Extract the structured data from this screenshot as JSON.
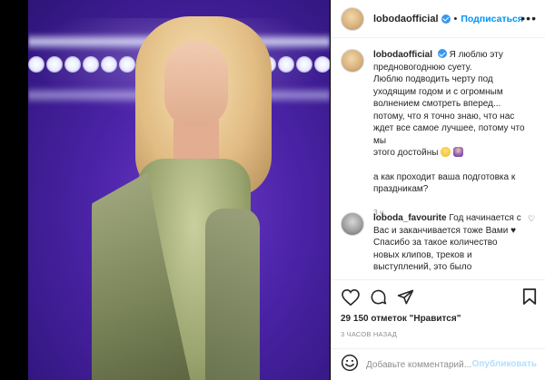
{
  "post": {
    "username": "lobodaofficial",
    "follow_label": "Подписаться",
    "separator": "•",
    "caption_lines": [
      "Я люблю эту",
      "предновогоднюю суету.",
      "Люблю подводить черту под",
      "уходящим годом и с огромным",
      "волнением смотреть вперед...",
      "потому, что я точно знаю, что нас",
      "ждет все самое лучшее, потому что мы",
      "этого достойны"
    ],
    "question_lines": [
      "а как проходит ваша подготовка к",
      "праздникам?"
    ],
    "caption_time": "3 ч.",
    "emoji": [
      "smile-emoji",
      "person-raising-hand-emoji"
    ]
  },
  "comment": {
    "username": "loboda_favourite",
    "text_lines": [
      "Год начинается с",
      "Вас и заканчивается тоже Вами",
      "Спасибо за такое количество",
      "новых клипов, треков и",
      "выступлений, это было"
    ],
    "heart_emoji": "black-heart"
  },
  "actions": {
    "icons": [
      "heart-icon",
      "comment-icon",
      "share-icon",
      "bookmark-icon"
    ]
  },
  "likes_text": "29 150 отметок \"Нравится\"",
  "timestamp_text": "3 ЧАСОВ НАЗАД",
  "add_comment": {
    "placeholder": "Добавьте комментарий...",
    "publish_label": "Опубликовать"
  },
  "colors": {
    "accent": "#0095f6",
    "verified": "#3897f0",
    "publish_disabled": "#b2dffc",
    "muted": "#8e8e8e",
    "background": "#000000"
  }
}
